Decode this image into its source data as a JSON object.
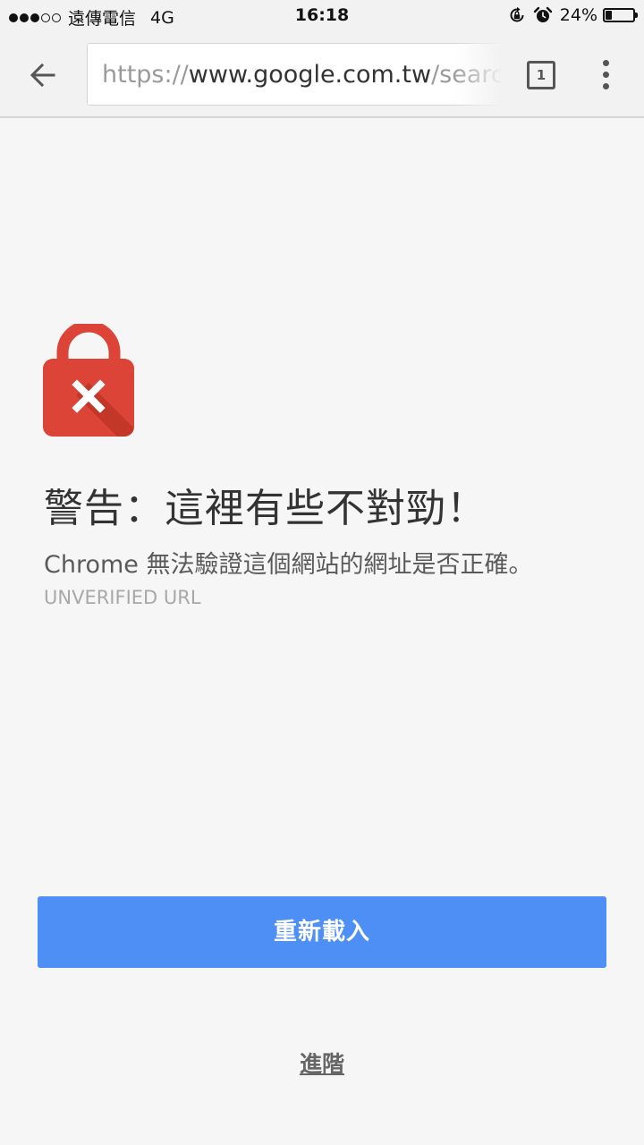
{
  "status_bar": {
    "signal_bars_filled": 3,
    "signal_bars_total": 5,
    "carrier": "遠傳電信",
    "network": "4G",
    "time": "16:18",
    "orientation_lock_icon": "orientation-lock-icon",
    "alarm_icon": "alarm-icon",
    "battery_percent_label": "24%",
    "battery_level": 0.24
  },
  "toolbar": {
    "back_icon": "arrow-left-icon",
    "url": {
      "scheme": "https://",
      "domain": "www.google.com.tw",
      "path": "/search"
    },
    "tab_count": "1",
    "menu_icon": "more-vertical-icon"
  },
  "interstitial": {
    "icon": "lock-error-icon",
    "icon_color": "#db4437",
    "title": "警告：這裡有些不對勁！",
    "message": "Chrome 無法驗證這個網站的網址是否正確。",
    "error_code": "UNVERIFIED URL",
    "reload_label": "重新載入",
    "reload_color": "#4d8ff5",
    "advanced_label": "進階"
  }
}
